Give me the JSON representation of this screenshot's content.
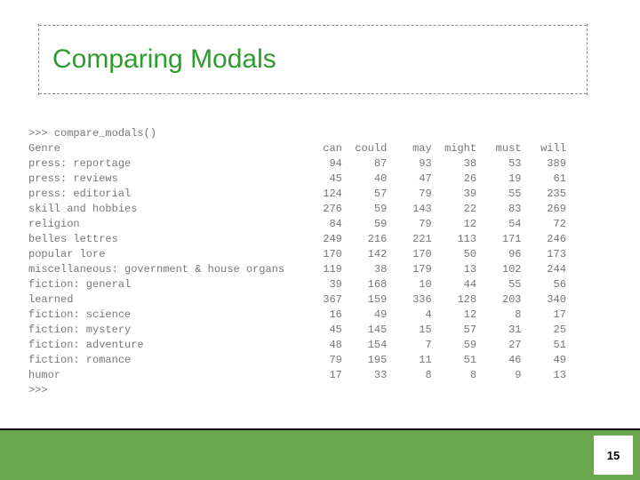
{
  "title": "Comparing Modals",
  "code": {
    "prompt_line": ">>> compare_modals()",
    "end_prompt": ">>>",
    "header_label": "Genre",
    "columns": [
      "can",
      "could",
      "may",
      "might",
      "must",
      "will"
    ],
    "rows": [
      {
        "genre": "press: reportage",
        "vals": [
          94,
          87,
          93,
          38,
          53,
          389
        ]
      },
      {
        "genre": "press: reviews",
        "vals": [
          45,
          40,
          47,
          26,
          19,
          61
        ]
      },
      {
        "genre": "press: editorial",
        "vals": [
          124,
          57,
          79,
          39,
          55,
          235
        ]
      },
      {
        "genre": "skill and hobbies",
        "vals": [
          276,
          59,
          143,
          22,
          83,
          269
        ]
      },
      {
        "genre": "religion",
        "vals": [
          84,
          59,
          79,
          12,
          54,
          72
        ]
      },
      {
        "genre": "belles lettres",
        "vals": [
          249,
          216,
          221,
          113,
          171,
          246
        ]
      },
      {
        "genre": "popular lore",
        "vals": [
          170,
          142,
          170,
          50,
          96,
          173
        ]
      },
      {
        "genre": "miscellaneous: government & house organs",
        "vals": [
          119,
          38,
          179,
          13,
          102,
          244
        ]
      },
      {
        "genre": "fiction: general",
        "vals": [
          39,
          168,
          10,
          44,
          55,
          56
        ]
      },
      {
        "genre": "learned",
        "vals": [
          367,
          159,
          336,
          128,
          203,
          340
        ]
      },
      {
        "genre": "fiction: science",
        "vals": [
          16,
          49,
          4,
          12,
          8,
          17
        ]
      },
      {
        "genre": "fiction: mystery",
        "vals": [
          45,
          145,
          15,
          57,
          31,
          25
        ]
      },
      {
        "genre": "fiction: adventure",
        "vals": [
          48,
          154,
          7,
          59,
          27,
          51
        ]
      },
      {
        "genre": "fiction: romance",
        "vals": [
          79,
          195,
          11,
          51,
          46,
          49
        ]
      },
      {
        "genre": "humor",
        "vals": [
          17,
          33,
          8,
          8,
          9,
          13
        ]
      }
    ]
  },
  "page_number": "15"
}
